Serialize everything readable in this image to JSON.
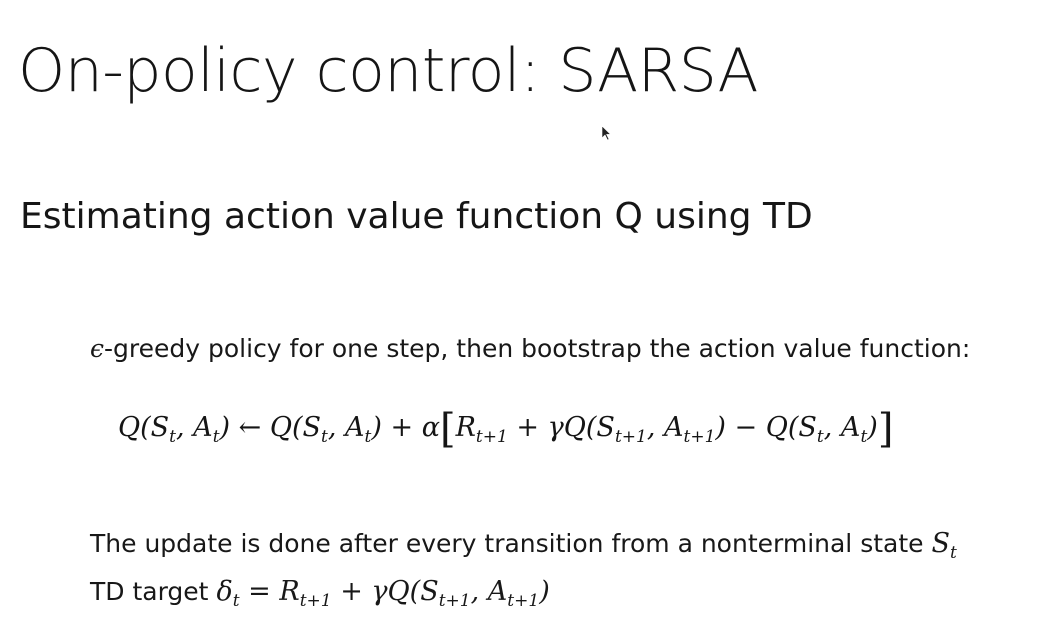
{
  "slide": {
    "title": "On-policy control: SARSA",
    "subtitle": "Estimating action value function Q using TD",
    "intro": {
      "epsilon": "ϵ",
      "text": "-greedy policy for one step, then bootstrap the action value function:"
    },
    "update_rule": "Q(S_t, A_t) ← Q(S_t, A_t) + α[R_{t+1} + γQ(S_{t+1}, A_{t+1}) − Q(S_t, A_t)]",
    "update_note": {
      "text": "The update is done after every transition from a nonterminal state ",
      "state_symbol": "S",
      "state_subscript": "t"
    },
    "td_target": {
      "label": "TD target ",
      "expression": "δ_t = R_{t+1} + γQ(S_{t+1}, A_{t+1})"
    }
  },
  "colors": {
    "text": "#151515",
    "background": "#ffffff"
  }
}
